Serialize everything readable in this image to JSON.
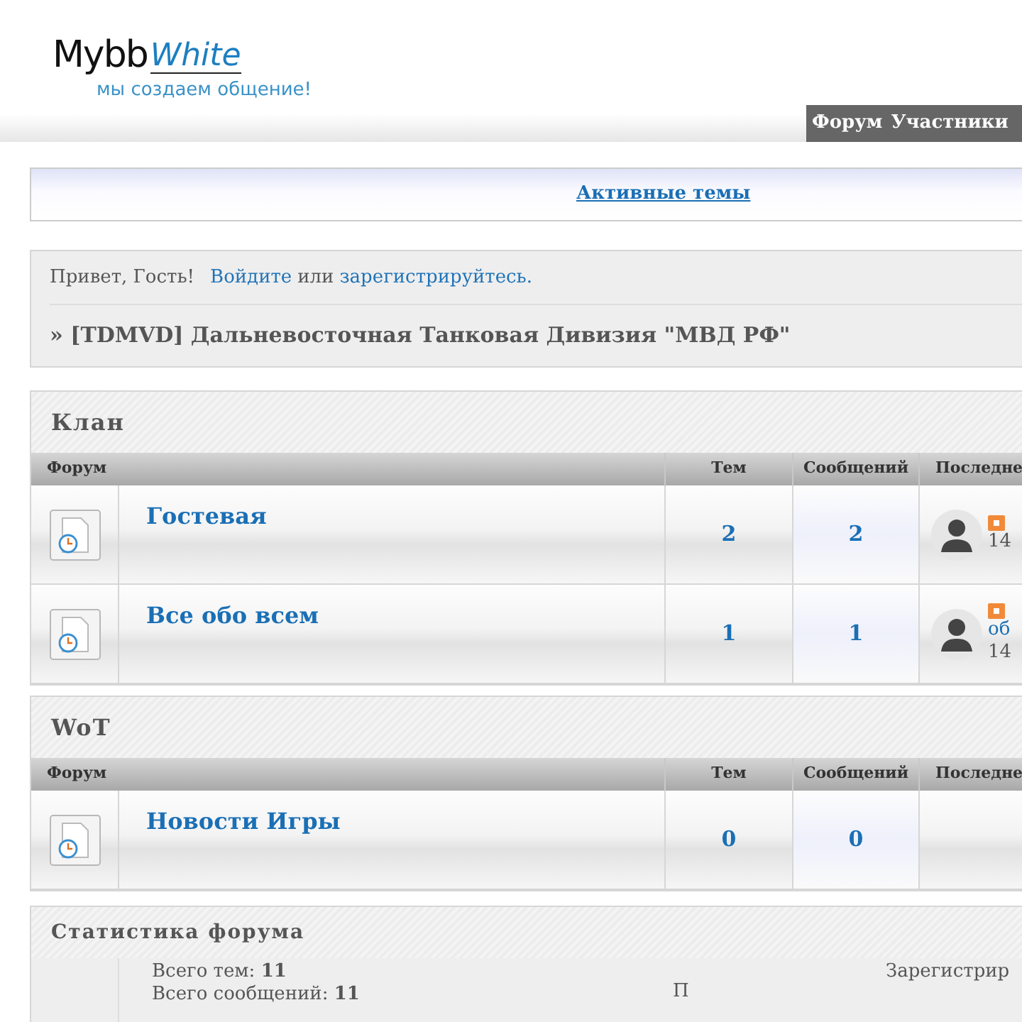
{
  "logo": {
    "brand": "Mybb",
    "script": "White",
    "tagline": "мы создаем общение!"
  },
  "nav": [
    "Форум",
    "Участники"
  ],
  "active_topics": "Активные темы",
  "welcome": {
    "greeting": "Привет, Гость!",
    "login": "Войдите",
    "or": "или",
    "register": "зарегистрируйтесь."
  },
  "breadcrumb": "» [TDMVD] Дальневосточная Танковая Дивизия \"МВД РФ\"",
  "categories": [
    {
      "title": "Клан",
      "columns": [
        "Форум",
        "Тем",
        "Сообщений",
        "Последне"
      ],
      "forums": [
        {
          "name": "Гостевая",
          "topics": "2",
          "posts": "2",
          "last_post": {
            "date": "14"
          }
        },
        {
          "name": "Все обо всем",
          "topics": "1",
          "posts": "1",
          "last_post": {
            "link": "об",
            "date": "14"
          }
        }
      ]
    },
    {
      "title": "WoT",
      "columns": [
        "Форум",
        "Тем",
        "Сообщений",
        "Последне"
      ],
      "forums": [
        {
          "name": "Новости Игры",
          "topics": "0",
          "posts": "0"
        }
      ]
    }
  ],
  "stats": {
    "title": "Статистика форума",
    "lines": [
      {
        "label": "Всего тем:",
        "value": "11"
      },
      {
        "label": "Всего сообщений:",
        "value": "11"
      }
    ],
    "middle": "П",
    "right": "Зарегистрир"
  }
}
